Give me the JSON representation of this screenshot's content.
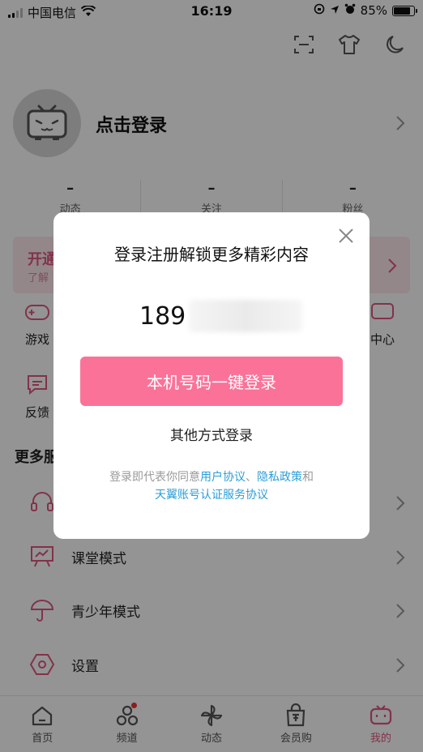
{
  "status_bar": {
    "carrier": "中国电信",
    "time": "16:19",
    "battery": "85%",
    "battery_level": 0.85
  },
  "profile": {
    "title": "点击登录"
  },
  "stats": [
    {
      "num": "–",
      "label": "动态"
    },
    {
      "num": "–",
      "label": "关注"
    },
    {
      "num": "–",
      "label": "粉丝"
    }
  ],
  "vip": {
    "title": "开通",
    "subtitle": "了解"
  },
  "grid": {
    "game": "游戏",
    "center": "中心",
    "feedback": "反馈"
  },
  "more_section": "更多服",
  "menu": [
    {
      "label": ""
    },
    {
      "label": "课堂模式"
    },
    {
      "label": "青少年模式"
    },
    {
      "label": "设置"
    }
  ],
  "tabs": [
    {
      "label": "首页"
    },
    {
      "label": "频道"
    },
    {
      "label": "动态"
    },
    {
      "label": "会员购"
    },
    {
      "label": "我的"
    }
  ],
  "modal": {
    "title": "登录注册解锁更多精彩内容",
    "phone_prefix": "189",
    "onekey_button": "本机号码一键登录",
    "other_login": "其他方式登录",
    "agreement_prefix": "登录即代表你同意",
    "user_agreement": "用户协议",
    "separator": "、",
    "privacy_policy": "隐私政策",
    "and": "和",
    "tianyi_agreement": "天翼账号认证服务协议"
  },
  "colors": {
    "accent": "#fb7299",
    "link": "#2c9ed8"
  }
}
